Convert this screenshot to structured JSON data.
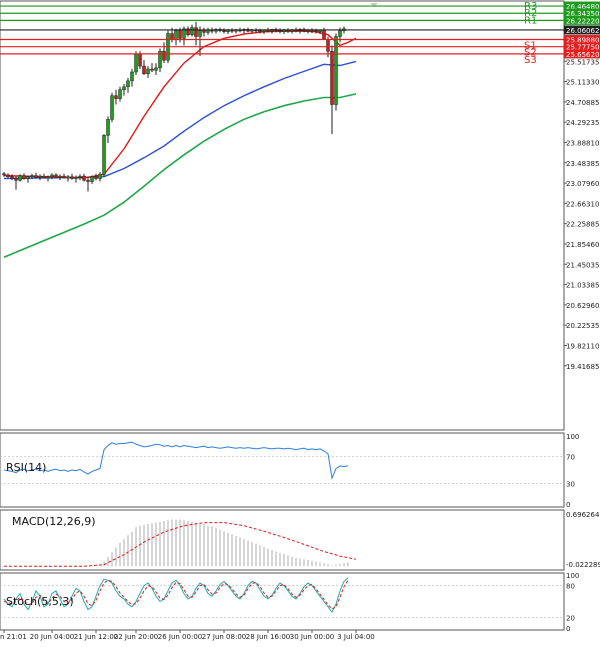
{
  "chart_data": {
    "type": "candlestick",
    "price_axis": {
      "range": [
        19.3,
        26.55
      ],
      "ticks": [
        "26.04250",
        "25.51735",
        "25.11330",
        "24.70885",
        "24.29235",
        "23.88810",
        "23.48385",
        "23.07960",
        "22.66310",
        "22.25885",
        "21.85460",
        "21.45035",
        "21.03385",
        "20.62960",
        "20.22535",
        "19.82110",
        "19.41685"
      ]
    },
    "levels": [
      {
        "label": "R3",
        "value_label": "26.46480",
        "value": 26.4648,
        "color": "#1e9a1e"
      },
      {
        "label": "R2",
        "value_label": "26.34350",
        "value": 26.3435,
        "color": "#1e9a1e"
      },
      {
        "label": "R1",
        "value_label": "26.22220",
        "value": 26.2222,
        "color": "#1e9a1e"
      },
      {
        "label": "",
        "value_label": "26.06062",
        "value": 26.0606,
        "color": "#222222"
      },
      {
        "label": "S1",
        "value_label": "25.89880",
        "value": 25.8988,
        "color": "#e02020"
      },
      {
        "label": "S2",
        "value_label": "25.77750",
        "value": 25.7775,
        "color": "#e02020"
      },
      {
        "label": "S3",
        "value_label": "25.65620",
        "value": 25.6562,
        "color": "#e02020"
      }
    ],
    "x_ticks": [
      {
        "label": "n 21:01",
        "i": 0
      },
      {
        "label": "20 Jun 04:00",
        "i": 12
      },
      {
        "label": "21 Jun 12:00",
        "i": 23
      },
      {
        "label": "22 Jun 20:00",
        "i": 33
      },
      {
        "label": "26 Jun 00:00",
        "i": 44
      },
      {
        "label": "27 Jun 08:00",
        "i": 55
      },
      {
        "label": "28 Jun 16:00",
        "i": 66
      },
      {
        "label": "30 Jun 00:00",
        "i": 77
      },
      {
        "label": "3 Jul 04:00",
        "i": 88
      }
    ],
    "candles": [
      [
        23.63,
        23.66,
        23.58,
        23.61
      ],
      [
        23.61,
        23.64,
        23.56,
        23.58
      ],
      [
        23.58,
        23.62,
        23.52,
        23.55
      ],
      [
        23.55,
        23.59,
        23.36,
        23.52
      ],
      [
        23.52,
        23.62,
        23.5,
        23.6
      ],
      [
        23.6,
        23.64,
        23.53,
        23.55
      ],
      [
        23.55,
        23.6,
        23.48,
        23.58
      ],
      [
        23.58,
        23.63,
        23.54,
        23.6
      ],
      [
        23.6,
        23.65,
        23.55,
        23.57
      ],
      [
        23.57,
        23.62,
        23.52,
        23.59
      ],
      [
        23.59,
        23.63,
        23.55,
        23.56
      ],
      [
        23.56,
        23.6,
        23.5,
        23.58
      ],
      [
        23.58,
        23.64,
        23.54,
        23.61
      ],
      [
        23.61,
        23.64,
        23.55,
        23.57
      ],
      [
        23.57,
        23.62,
        23.52,
        23.59
      ],
      [
        23.59,
        23.63,
        23.55,
        23.56
      ],
      [
        23.56,
        23.61,
        23.5,
        23.58
      ],
      [
        23.58,
        23.63,
        23.53,
        23.55
      ],
      [
        23.55,
        23.6,
        23.48,
        23.57
      ],
      [
        23.57,
        23.62,
        23.52,
        23.59
      ],
      [
        23.59,
        23.63,
        23.5,
        23.52
      ],
      [
        23.52,
        23.58,
        23.33,
        23.5
      ],
      [
        23.5,
        23.6,
        23.46,
        23.58
      ],
      [
        23.58,
        23.63,
        23.52,
        23.55
      ],
      [
        23.55,
        23.66,
        23.5,
        23.62
      ],
      [
        23.62,
        24.3,
        23.58,
        24.28
      ],
      [
        24.28,
        24.6,
        24.15,
        24.55
      ],
      [
        24.55,
        25.0,
        24.5,
        24.95
      ],
      [
        24.95,
        25.05,
        24.8,
        24.9
      ],
      [
        24.9,
        25.1,
        24.85,
        25.05
      ],
      [
        25.05,
        25.15,
        24.95,
        25.1
      ],
      [
        25.1,
        25.25,
        25.0,
        25.2
      ],
      [
        25.2,
        25.4,
        25.1,
        25.35
      ],
      [
        25.35,
        25.7,
        25.3,
        25.65
      ],
      [
        25.65,
        25.7,
        25.4,
        25.45
      ],
      [
        25.45,
        25.55,
        25.3,
        25.32
      ],
      [
        25.32,
        25.45,
        25.25,
        25.4
      ],
      [
        25.4,
        25.5,
        25.35,
        25.38
      ],
      [
        25.38,
        25.5,
        25.3,
        25.42
      ],
      [
        25.42,
        25.75,
        25.35,
        25.7
      ],
      [
        25.7,
        25.85,
        25.5,
        25.55
      ],
      [
        25.55,
        26.05,
        25.5,
        26.0
      ],
      [
        26.0,
        26.1,
        25.85,
        25.9
      ],
      [
        25.9,
        26.08,
        25.8,
        26.05
      ],
      [
        26.05,
        26.1,
        25.85,
        25.92
      ],
      [
        25.92,
        26.12,
        25.8,
        26.08
      ],
      [
        26.08,
        26.12,
        25.95,
        25.98
      ],
      [
        25.98,
        26.15,
        25.95,
        26.1
      ],
      [
        26.1,
        26.2,
        25.8,
        25.95
      ],
      [
        25.95,
        26.12,
        25.62,
        26.05
      ],
      [
        26.05,
        26.1,
        25.95,
        26.02
      ],
      [
        26.02,
        26.1,
        25.98,
        26.06
      ],
      [
        26.06,
        26.1,
        26.0,
        26.04
      ],
      [
        26.04,
        26.09,
        26.0,
        26.07
      ],
      [
        26.07,
        26.1,
        26.02,
        26.05
      ],
      [
        26.05,
        26.09,
        26.0,
        26.03
      ],
      [
        26.03,
        26.08,
        25.99,
        26.06
      ],
      [
        26.06,
        26.09,
        26.01,
        26.04
      ],
      [
        26.04,
        26.08,
        26.0,
        26.06
      ],
      [
        26.06,
        26.1,
        26.02,
        26.05
      ],
      [
        26.05,
        26.09,
        26.0,
        26.07
      ],
      [
        26.07,
        26.1,
        26.02,
        26.04
      ],
      [
        26.04,
        26.08,
        26.0,
        26.06
      ],
      [
        26.06,
        26.09,
        26.01,
        26.05
      ],
      [
        26.05,
        26.08,
        26.0,
        26.03
      ],
      [
        26.03,
        26.07,
        25.99,
        26.06
      ],
      [
        26.06,
        26.1,
        26.02,
        26.04
      ],
      [
        26.04,
        26.08,
        26.0,
        26.07
      ],
      [
        26.07,
        26.1,
        26.02,
        26.05
      ],
      [
        26.05,
        26.09,
        26.0,
        26.03
      ],
      [
        26.03,
        26.08,
        25.99,
        26.06
      ],
      [
        26.06,
        26.09,
        26.01,
        26.04
      ],
      [
        26.04,
        26.08,
        26.0,
        26.06
      ],
      [
        26.06,
        26.1,
        26.02,
        26.05
      ],
      [
        26.05,
        26.09,
        26.0,
        26.07
      ],
      [
        26.07,
        26.1,
        26.02,
        26.04
      ],
      [
        26.04,
        26.08,
        26.0,
        26.06
      ],
      [
        26.06,
        26.09,
        26.01,
        26.05
      ],
      [
        26.05,
        26.08,
        26.0,
        26.03
      ],
      [
        26.03,
        26.07,
        25.99,
        26.06
      ],
      [
        26.06,
        26.1,
        25.95,
        25.9
      ],
      [
        25.9,
        25.95,
        25.6,
        25.7
      ],
      [
        25.7,
        25.8,
        24.3,
        24.8
      ],
      [
        24.8,
        26.0,
        24.7,
        25.95
      ],
      [
        25.95,
        26.1,
        25.85,
        26.05
      ],
      [
        26.05,
        26.12,
        26.0,
        26.08
      ]
    ],
    "ma_fast": {
      "color": "#e01818",
      "points": [
        [
          0,
          23.6
        ],
        [
          10,
          23.58
        ],
        [
          20,
          23.56
        ],
        [
          25,
          23.62
        ],
        [
          30,
          24.05
        ],
        [
          35,
          24.6
        ],
        [
          40,
          25.1
        ],
        [
          45,
          25.5
        ],
        [
          50,
          25.78
        ],
        [
          55,
          25.92
        ],
        [
          60,
          25.99
        ],
        [
          65,
          26.03
        ],
        [
          70,
          26.04
        ],
        [
          75,
          26.04
        ],
        [
          78,
          26.03
        ],
        [
          81,
          25.98
        ],
        [
          84,
          25.8
        ],
        [
          86,
          25.85
        ],
        [
          88,
          25.92
        ]
      ]
    },
    "ma_mid": {
      "color": "#2b4fd8",
      "points": [
        [
          0,
          23.55
        ],
        [
          10,
          23.56
        ],
        [
          20,
          23.57
        ],
        [
          25,
          23.58
        ],
        [
          30,
          23.72
        ],
        [
          35,
          23.9
        ],
        [
          40,
          24.1
        ],
        [
          45,
          24.35
        ],
        [
          50,
          24.58
        ],
        [
          55,
          24.78
        ],
        [
          60,
          24.95
        ],
        [
          65,
          25.1
        ],
        [
          70,
          25.24
        ],
        [
          75,
          25.36
        ],
        [
          80,
          25.48
        ],
        [
          84,
          25.46
        ],
        [
          88,
          25.53
        ]
      ]
    },
    "ma_slow": {
      "color": "#1ea84a",
      "points": [
        [
          0,
          22.22
        ],
        [
          10,
          22.5
        ],
        [
          20,
          22.78
        ],
        [
          25,
          22.93
        ],
        [
          30,
          23.15
        ],
        [
          35,
          23.42
        ],
        [
          40,
          23.7
        ],
        [
          45,
          23.95
        ],
        [
          50,
          24.18
        ],
        [
          55,
          24.38
        ],
        [
          60,
          24.55
        ],
        [
          65,
          24.68
        ],
        [
          70,
          24.78
        ],
        [
          75,
          24.86
        ],
        [
          80,
          24.92
        ],
        [
          84,
          24.92
        ],
        [
          88,
          24.98
        ]
      ]
    },
    "rsi": {
      "label": "RSI(14)",
      "ticks": [
        "100",
        "70",
        "30",
        "0"
      ],
      "range": [
        0,
        100
      ],
      "values": [
        50,
        49,
        48,
        46,
        50,
        51,
        49,
        50,
        51,
        49,
        50,
        48,
        50,
        51,
        49,
        50,
        48,
        50,
        49,
        51,
        47,
        44,
        48,
        50,
        52,
        80,
        86,
        90,
        88,
        89,
        89,
        90,
        91,
        88,
        86,
        84,
        85,
        86,
        88,
        87,
        85,
        86,
        84,
        86,
        84,
        86,
        85,
        84,
        83,
        84,
        85,
        83,
        84,
        83,
        82,
        83,
        84,
        83,
        82,
        83,
        82,
        83,
        82,
        81,
        82,
        83,
        82,
        81,
        82,
        82,
        81,
        82,
        81,
        80,
        81,
        82,
        80,
        81,
        80,
        81,
        78,
        74,
        38,
        52,
        56,
        55,
        56
      ]
    },
    "macd": {
      "label": "MACD(12,26,9)",
      "ticks": [
        "0.696264",
        "-0.022289"
      ],
      "range": [
        -0.022289,
        0.696264
      ],
      "hist": [
        0.0,
        0.0,
        0.0,
        0.0,
        0.0,
        0.0,
        0.0,
        0.0,
        0.0,
        0.0,
        0.0,
        0.0,
        0.0,
        0.0,
        0.0,
        0.0,
        0.0,
        0.0,
        0.0,
        0.0,
        0.0,
        0.0,
        0.0,
        0.0,
        0.0,
        0.06,
        0.12,
        0.18,
        0.24,
        0.3,
        0.35,
        0.4,
        0.44,
        0.5,
        0.52,
        0.53,
        0.54,
        0.55,
        0.56,
        0.57,
        0.58,
        0.59,
        0.6,
        0.6,
        0.6,
        0.59,
        0.58,
        0.57,
        0.56,
        0.55,
        0.54,
        0.52,
        0.51,
        0.49,
        0.47,
        0.45,
        0.43,
        0.41,
        0.39,
        0.37,
        0.35,
        0.33,
        0.31,
        0.29,
        0.27,
        0.25,
        0.23,
        0.21,
        0.19,
        0.17,
        0.16,
        0.14,
        0.12,
        0.11,
        0.1,
        0.09,
        0.08,
        0.07,
        0.06,
        0.05,
        0.04,
        0.03,
        0.01,
        0.02,
        0.03,
        0.04,
        0.05
      ],
      "signal_points": [
        [
          0,
          0.0
        ],
        [
          20,
          0.0
        ],
        [
          25,
          0.02
        ],
        [
          30,
          0.15
        ],
        [
          35,
          0.31
        ],
        [
          40,
          0.44
        ],
        [
          45,
          0.52
        ],
        [
          50,
          0.56
        ],
        [
          55,
          0.56
        ],
        [
          60,
          0.52
        ],
        [
          65,
          0.45
        ],
        [
          70,
          0.37
        ],
        [
          75,
          0.28
        ],
        [
          80,
          0.19
        ],
        [
          84,
          0.13
        ],
        [
          88,
          0.09
        ]
      ]
    },
    "stoch": {
      "label": "Stoch(5,5,3)",
      "ticks": [
        "100",
        "80",
        "20",
        "0"
      ],
      "range": [
        0,
        100
      ],
      "k": [
        55,
        45,
        40,
        55,
        65,
        45,
        35,
        50,
        70,
        60,
        40,
        45,
        65,
        70,
        55,
        40,
        45,
        60,
        75,
        70,
        50,
        35,
        40,
        60,
        80,
        92,
        90,
        85,
        70,
        60,
        55,
        45,
        40,
        50,
        65,
        80,
        85,
        75,
        60,
        50,
        55,
        70,
        85,
        90,
        80,
        65,
        55,
        60,
        75,
        85,
        80,
        65,
        60,
        70,
        82,
        88,
        80,
        70,
        60,
        55,
        65,
        80,
        88,
        85,
        72,
        60,
        55,
        62,
        75,
        85,
        80,
        70,
        60,
        55,
        65,
        78,
        85,
        80,
        70,
        60,
        50,
        40,
        30,
        45,
        70,
        88,
        95
      ],
      "d": [
        50,
        48,
        45,
        50,
        58,
        52,
        44,
        46,
        58,
        62,
        52,
        46,
        56,
        64,
        60,
        50,
        46,
        54,
        66,
        70,
        60,
        46,
        42,
        52,
        70,
        85,
        90,
        88,
        78,
        66,
        58,
        50,
        44,
        46,
        56,
        70,
        80,
        78,
        68,
        56,
        54,
        62,
        76,
        86,
        84,
        72,
        60,
        58,
        68,
        80,
        82,
        72,
        64,
        66,
        76,
        84,
        82,
        74,
        64,
        58,
        62,
        74,
        84,
        86,
        78,
        66,
        58,
        60,
        70,
        80,
        82,
        74,
        64,
        58,
        62,
        72,
        80,
        82,
        74,
        64,
        54,
        44,
        36,
        40,
        58,
        78,
        90
      ]
    }
  }
}
